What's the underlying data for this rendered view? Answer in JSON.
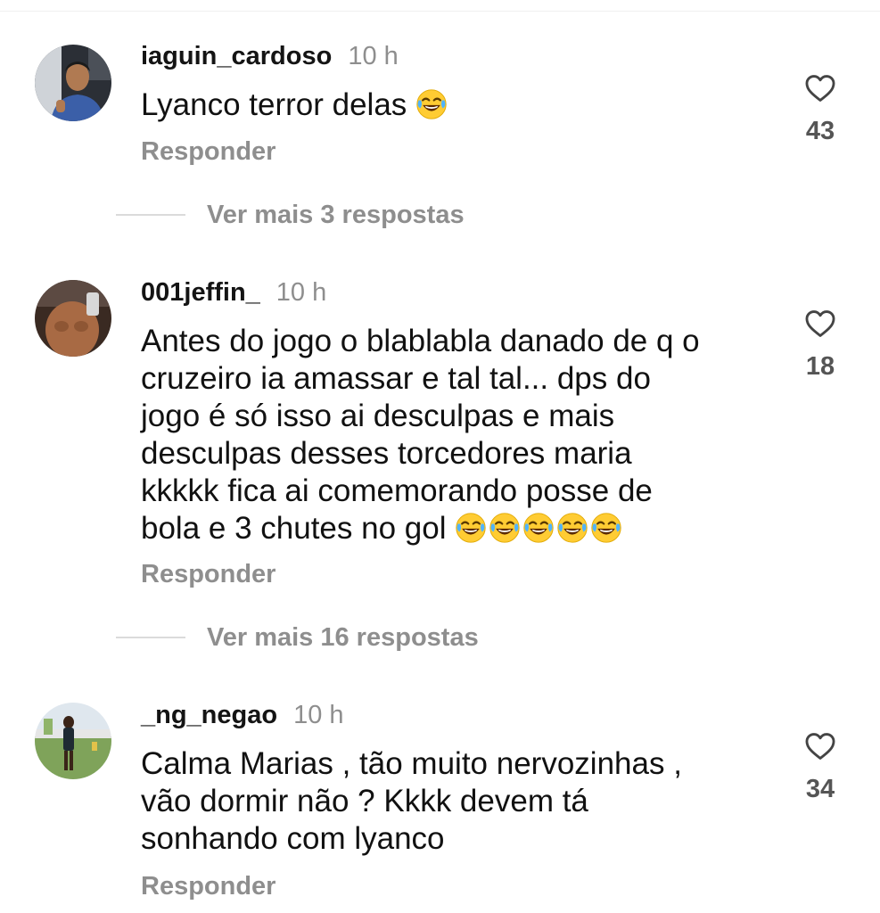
{
  "comments": [
    {
      "username": "iaguin_cardoso",
      "time": "10 h",
      "text": "Lyanco terror delas",
      "emoji_count": 1,
      "likes": "43",
      "reply_label": "Responder",
      "more_replies": "Ver mais 3 respostas"
    },
    {
      "username": "001jeffin_",
      "time": "10 h",
      "text_lines": [
        "Antes do jogo o blablabla danado de q o",
        "cruzeiro ia amassar e tal tal... dps do",
        "jogo é só isso ai desculpas e mais",
        "desculpas desses torcedores maria",
        "kkkkk fica ai comemorando posse de",
        "bola e 3 chutes no gol"
      ],
      "emoji_count": 5,
      "likes": "18",
      "reply_label": "Responder",
      "more_replies": "Ver mais 16 respostas"
    },
    {
      "username": "_ng_negao",
      "time": "10 h",
      "text_lines": [
        "Calma Marias , tão muito nervozinhas ,",
        "vão dormir não ? Kkkk devem tá",
        "sonhando com lyanco"
      ],
      "likes": "34",
      "reply_label": "Responder"
    }
  ],
  "icons": {
    "like": "heart-outline-icon",
    "emoji": "face-with-tears-of-joy"
  },
  "colors": {
    "text": "#111111",
    "muted": "#8e8e8e",
    "divider": "#dbdbdb",
    "emoji_face": "#ffcc33"
  }
}
